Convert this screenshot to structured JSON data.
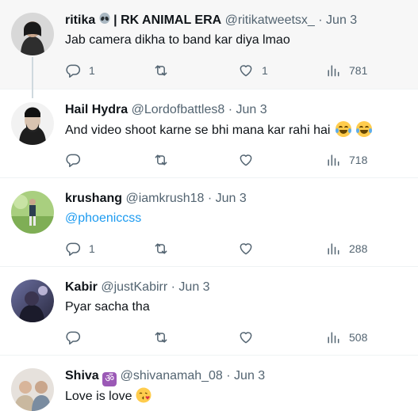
{
  "tweets": [
    {
      "name": "ritika",
      "name_suffix": "| RK ANIMAL ERA",
      "handle": "@ritikatweetsx_",
      "date": "· Jun 3",
      "text": "Jab camera dikha to band kar diya lmao",
      "replies": "1",
      "retweets": "",
      "likes": "1",
      "views": "781",
      "avatar_color": "#3a3f44"
    },
    {
      "name": "Hail Hydra",
      "handle": "@Lordofbattles8",
      "date": "· Jun 3",
      "text": "And video shoot karne se bhi mana kar rahi hai",
      "replies": "",
      "retweets": "",
      "likes": "",
      "views": "718",
      "avatar_color": "#2b2b2b"
    },
    {
      "name": "krushang",
      "handle": "@iamkrush18",
      "date": "· Jun 3",
      "mention": "@phoeniccss",
      "replies": "1",
      "retweets": "",
      "likes": "",
      "views": "288",
      "avatar_color": "#8fb56a"
    },
    {
      "name": "Kabir",
      "handle": "@justKabirr",
      "date": "· Jun 3",
      "text": "Pyar sacha tha",
      "replies": "",
      "retweets": "",
      "likes": "",
      "views": "508",
      "avatar_color": "#4a4a6a"
    },
    {
      "name": "Shiva",
      "badge": "ॐ",
      "handle": "@shivanamah_08",
      "date": "· Jun 3",
      "text": "Love is love",
      "avatar_color": "#8a8a8a"
    }
  ],
  "icons": {
    "reply": "reply-icon",
    "retweet": "retweet-icon",
    "like": "heart-icon",
    "views": "views-icon"
  },
  "colors": {
    "mention": "#1d9bf0",
    "muted": "#536471",
    "highlight_bg": "#f7f7f7"
  }
}
